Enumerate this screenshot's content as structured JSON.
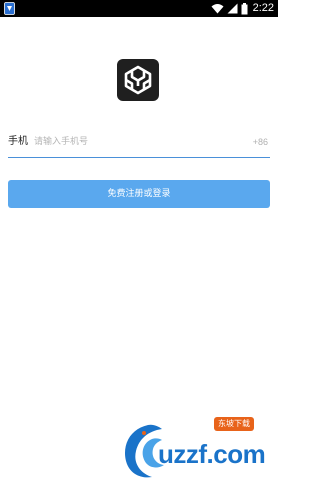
{
  "status_bar": {
    "time": "2:22",
    "icons": [
      "app-notification-icon",
      "wifi-icon",
      "signal-icon",
      "battery-icon"
    ]
  },
  "app": {
    "logo_icon": "cube-logo-icon"
  },
  "form": {
    "phone_label": "手机",
    "phone_placeholder": "请输入手机号",
    "phone_value": "",
    "country_code": "+86",
    "submit_label": "免费注册或登录"
  },
  "watermark": {
    "badge_text": "东坡下载",
    "site_text": "uzzf.com"
  },
  "colors": {
    "accent": "#5aa8ee",
    "underline": "#4a90d9",
    "status_bar": "#000000",
    "logo_bg": "#1f1f1f"
  }
}
